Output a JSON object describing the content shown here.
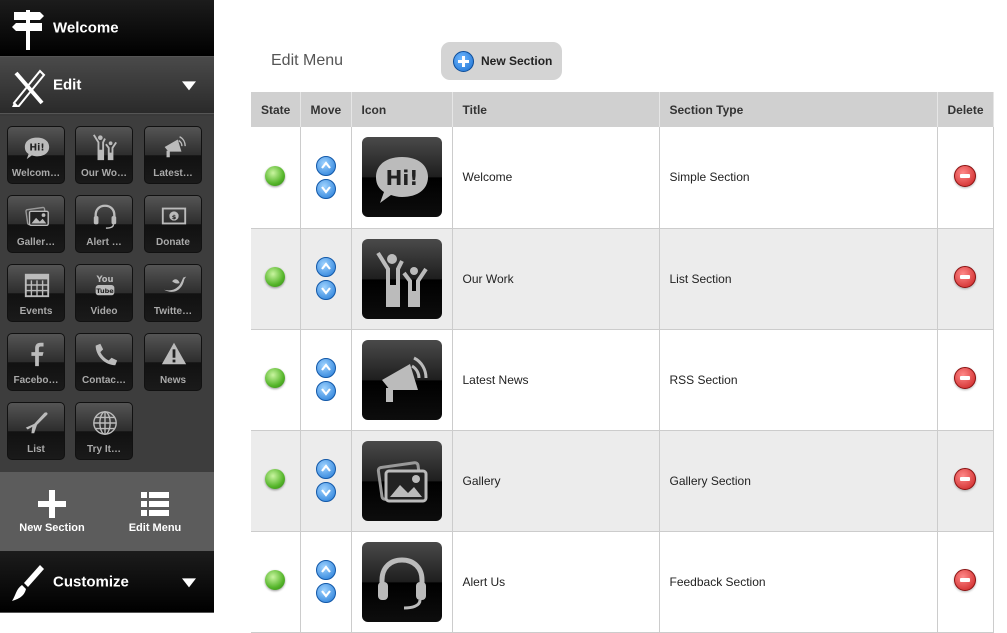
{
  "sidebar": {
    "welcome_label": "Welcome",
    "edit_label": "Edit",
    "customize_label": "Customize",
    "tiles": [
      {
        "label": "Welcom…",
        "icon": "hi-speech-icon"
      },
      {
        "label": "Our Wo…",
        "icon": "people-icon"
      },
      {
        "label": "Latest…",
        "icon": "megaphone-icon"
      },
      {
        "label": "Galler…",
        "icon": "gallery-icon"
      },
      {
        "label": "Alert …",
        "icon": "headset-icon"
      },
      {
        "label": "Donate",
        "icon": "dollar-icon"
      },
      {
        "label": "Events",
        "icon": "calendar-icon"
      },
      {
        "label": "Video",
        "icon": "youtube-icon"
      },
      {
        "label": "Twitte…",
        "icon": "twitter-bird-icon"
      },
      {
        "label": "Facebo…",
        "icon": "facebook-icon"
      },
      {
        "label": "Contac…",
        "icon": "phone-icon"
      },
      {
        "label": "News",
        "icon": "warning-icon"
      },
      {
        "label": "List",
        "icon": "airplane-icon"
      },
      {
        "label": "Try It…",
        "icon": "globe-icon"
      }
    ],
    "actions": {
      "new_section_label": "New Section",
      "edit_menu_label": "Edit Menu"
    }
  },
  "main": {
    "title": "Edit Menu",
    "new_section_button": "New Section",
    "columns": [
      "State",
      "Move",
      "Icon",
      "Title",
      "Section Type",
      "Delete"
    ],
    "rows": [
      {
        "title": "Welcome",
        "type": "Simple Section",
        "icon": "hi-speech-icon"
      },
      {
        "title": "Our Work",
        "type": "List Section",
        "icon": "people-icon"
      },
      {
        "title": "Latest News",
        "type": "RSS Section",
        "icon": "megaphone-icon"
      },
      {
        "title": "Gallery",
        "type": "Gallery Section",
        "icon": "gallery-icon"
      },
      {
        "title": "Alert Us",
        "type": "Feedback Section",
        "icon": "headset-icon"
      }
    ]
  },
  "colors": {
    "state_active": "#55b52a",
    "move_button": "#1f78d6",
    "delete_button": "#c91e1e",
    "header_bg": "#d0d0d0"
  }
}
